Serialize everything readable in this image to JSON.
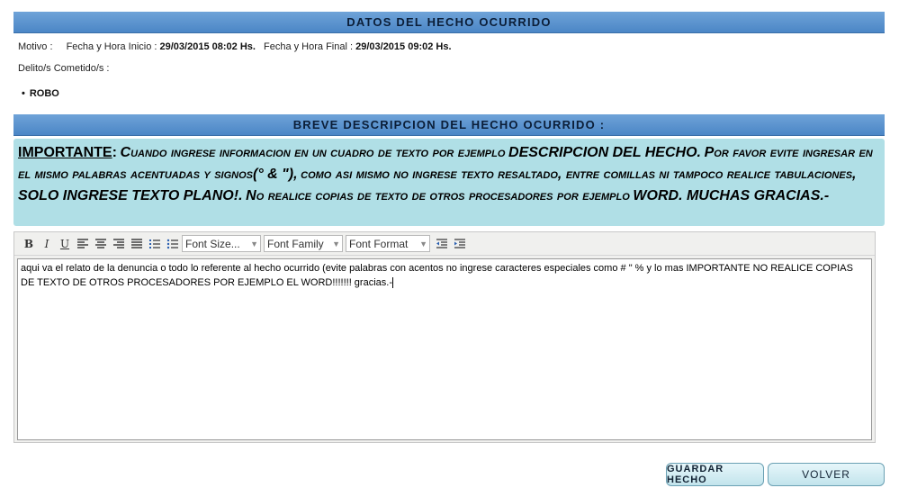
{
  "section1": {
    "title": "DATOS DEL HECHO OCURRIDO"
  },
  "info": {
    "motivo_label": "Motivo :",
    "inicio_label": "Fecha y Hora Inicio :",
    "inicio_value": "29/03/2015 08:02 Hs.",
    "final_label": "Fecha y Hora Final :",
    "final_value": "29/03/2015 09:02 Hs."
  },
  "delitos": {
    "label": "Delito/s Cometido/s :",
    "items": [
      "ROBO"
    ]
  },
  "section2": {
    "title": "BREVE DESCRIPCION DEL HECHO OCURRIDO :"
  },
  "notice": {
    "important": "IMPORTANTE",
    "colon": ":",
    "p1": "Cuando ingrese informacion en un cuadro de texto por ejemplo",
    "b1": "DESCRIPCION DEL HECHO.",
    "p2": "Por favor evite ingresar en el mismo palabras acentuadas y signos",
    "b2": "(° & \"),",
    "p3": "como asi mismo no ingrese texto resaltado, entre comillas ni tampoco realice tabulaciones,",
    "b3": "SOLO INGRESE TEXTO PLANO!.",
    "p4": "No realice copias de texto de otros procesadores por ejemplo",
    "b4": "WORD. MUCHAS GRACIAS.-"
  },
  "toolbar": {
    "bold_icon": "B",
    "italic_icon": "I",
    "underline_icon": "U",
    "font_size": "Font Size...",
    "font_family": "Font Family",
    "font_format": "Font Format"
  },
  "editor": {
    "text": "aqui va el relato de la denuncia o todo lo referente al hecho ocurrido  (evite palabras con acentos no ingrese caracteres especiales como # \" % y lo mas IMPORTANTE NO REALICE COPIAS DE TEXTO DE OTROS PROCESADORES POR EJEMPLO EL WORD!!!!!!! gracias.-"
  },
  "buttons": {
    "guardar": "GUARDAR HECHO",
    "volver": "VOLVER"
  }
}
